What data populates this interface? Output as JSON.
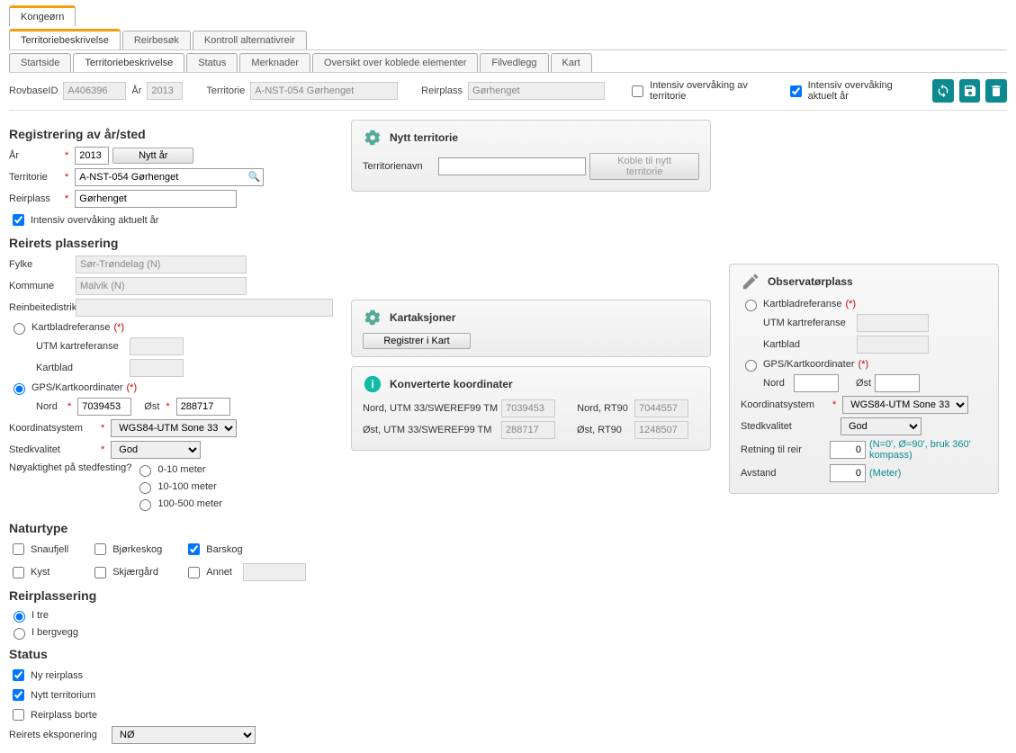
{
  "tabs_main": {
    "kongeorn": "Kongeørn"
  },
  "tabs_sub": {
    "terr": "Territoriebeskrivelse",
    "reir": "Reirbesøk",
    "kontroll": "Kontroll alternativreir"
  },
  "tabs_page": {
    "startside": "Startside",
    "terr": "Territoriebeskrivelse",
    "status": "Status",
    "merknader": "Merknader",
    "oversikt": "Oversikt over koblede elementer",
    "filvedlegg": "Filvedlegg",
    "kart": "Kart"
  },
  "topbar": {
    "rovbaseid_label": "RovbaseID",
    "rovbaseid_value": "A406396",
    "ar_label": "År",
    "ar_value": "2013",
    "territorie_label": "Territorie",
    "territorie_value": "A-NST-054 Gørhenget",
    "reirplass_label": "Reirplass",
    "reirplass_value": "Gørhenget",
    "intensiv_terr": "Intensiv overvåking av territorie",
    "intensiv_aktuelt": "Intensiv overvåking aktuelt år"
  },
  "reg": {
    "title": "Registrering av år/sted",
    "ar_label": "År",
    "ar_value": "2013",
    "nytt_ar_btn": "Nytt år",
    "territorie_label": "Territorie",
    "territorie_value": "A-NST-054 Gørhenget",
    "reirplass_label": "Reirplass",
    "reirplass_value": "Gørhenget",
    "intensiv_chk": "Intensiv overvåking aktuelt år"
  },
  "nytt_terr": {
    "title": "Nytt territorie",
    "navn_label": "Territorienavn",
    "koble_btn": "Koble til nytt territorie"
  },
  "plassering": {
    "title": "Reirets plassering",
    "fylke_label": "Fylke",
    "fylke_value": "Sør-Trøndelag (N)",
    "kommune_label": "Kommune",
    "kommune_value": "Malvik (N)",
    "reinbeite_label": "Reinbeitedistrikt",
    "kartblad_ref": "Kartbladreferanse",
    "utm_label": "UTM kartreferanse",
    "kartblad_label": "Kartblad",
    "gps_label": "GPS/Kartkoordinater",
    "nord_label": "Nord",
    "nord_val": "7039453",
    "ost_label": "Øst",
    "ost_val": "288717",
    "koordsys_label": "Koordinatsystem",
    "koordsys_val": "WGS84-UTM Sone 33",
    "stedkval_label": "Stedkvalitet",
    "stedkval_val": "God",
    "noyakt_label": "Nøyaktighet på stedfesting?",
    "noy_0_10": "0-10 meter",
    "noy_10_100": "10-100 meter",
    "noy_100_500": "100-500 meter",
    "paren_star": "(*)"
  },
  "kartaksjoner": {
    "title": "Kartaksjoner",
    "registrer_btn": "Registrer i Kart"
  },
  "konv": {
    "title": "Konverterte koordinater",
    "nord_utm_label": "Nord, UTM 33/SWEREF99 TM",
    "nord_utm_val": "7039453",
    "ost_utm_label": "Øst, UTM 33/SWEREF99 TM",
    "ost_utm_val": "288717",
    "nord_rt_label": "Nord, RT90",
    "nord_rt_val": "7044557",
    "ost_rt_label": "Øst, RT90",
    "ost_rt_val": "1248507"
  },
  "obs": {
    "title": "Observatørplass",
    "kartblad_ref": "Kartbladreferanse",
    "utm_label": "UTM kartreferanse",
    "kartblad_label": "Kartblad",
    "gps_label": "GPS/Kartkoordinater",
    "nord_label": "Nord",
    "ost_label": "Øst",
    "koordsys_label": "Koordinatsystem",
    "koordsys_val": "WGS84-UTM Sone 33",
    "stedkval_label": "Stedkvalitet",
    "stedkval_val": "God",
    "retning_label": "Retning til reir",
    "retning_val": "0",
    "retning_hint": "(N=0', Ø=90', bruk 360' kompass)",
    "avstand_label": "Avstand",
    "avstand_val": "0",
    "avstand_hint": "(Meter)",
    "paren_star": "(*)"
  },
  "naturtype": {
    "title": "Naturtype",
    "snaufjell": "Snaufjell",
    "bjork": "Bjørkeskog",
    "barskog": "Barskog",
    "kyst": "Kyst",
    "skjaer": "Skjærgård",
    "annet": "Annet"
  },
  "reirpl": {
    "title": "Reirplassering",
    "itre": "I tre",
    "ibergvegg": "I bergvegg"
  },
  "status": {
    "title": "Status",
    "ny_reir": "Ny reirplass",
    "nytt_terr": "Nytt territorium",
    "reir_borte": "Reirplass borte",
    "reirets_eksp": "Reirets eksponering",
    "eksp_val": "NØ"
  }
}
